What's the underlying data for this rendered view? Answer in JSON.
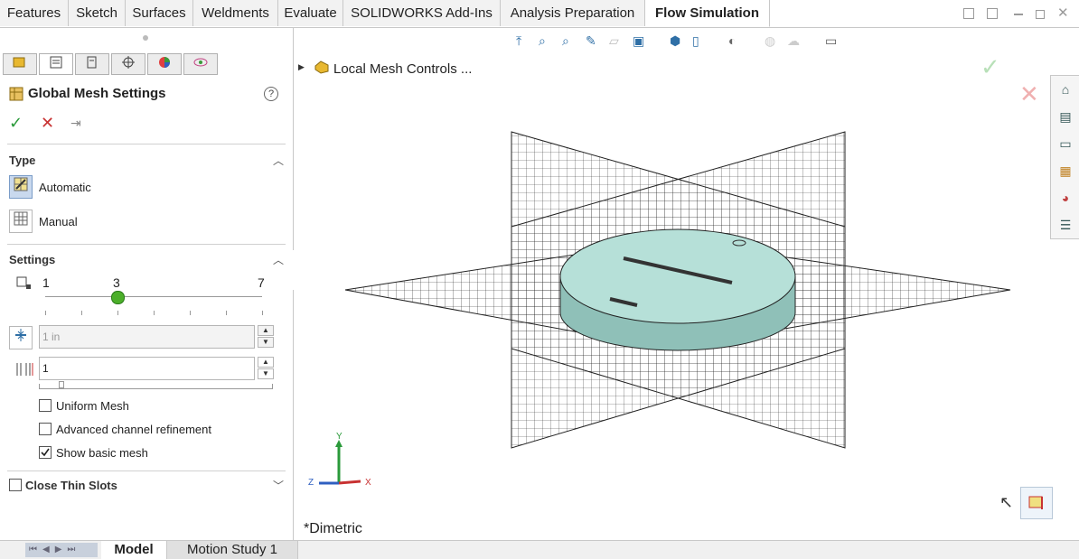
{
  "tabs": [
    {
      "label": "Features",
      "active": false
    },
    {
      "label": "Sketch",
      "active": false
    },
    {
      "label": "Surfaces",
      "active": false
    },
    {
      "label": "Weldments",
      "active": false
    },
    {
      "label": "Evaluate",
      "active": false
    },
    {
      "label": "SOLIDWORKS Add-Ins",
      "active": false
    },
    {
      "label": "Analysis Preparation",
      "active": false
    },
    {
      "label": "Flow Simulation",
      "active": true
    }
  ],
  "panel": {
    "title": "Global Mesh Settings",
    "help_icon": "help-icon",
    "ok_icon": "checkmark-icon",
    "cancel_icon": "close-icon",
    "pin_icon": "pushpin-icon",
    "type": {
      "heading": "Type",
      "options": [
        {
          "label": "Automatic",
          "selected": true
        },
        {
          "label": "Manual",
          "selected": false
        }
      ]
    },
    "settings": {
      "heading": "Settings",
      "slider": {
        "min_label": "1",
        "value_label": "3",
        "max_label": "7",
        "value": 3
      },
      "min_gap_value": "1 in",
      "count_value": "1",
      "checkboxes": [
        {
          "label": "Uniform Mesh",
          "checked": false
        },
        {
          "label": "Advanced channel refinement",
          "checked": false
        },
        {
          "label": "Show basic mesh",
          "checked": true
        }
      ]
    },
    "close_thin_slots": {
      "label": "Close Thin Slots",
      "checked": false
    }
  },
  "viewport": {
    "tree_item": "Local Mesh Controls ...",
    "view_label": "*Dimetric",
    "triad": {
      "y": "Y",
      "x": "X",
      "z": "Z"
    }
  },
  "bottom_tabs": [
    {
      "label": "Model",
      "active": true
    },
    {
      "label": "Motion Study 1",
      "active": false
    }
  ],
  "colors": {
    "accent": "#2f6fa6",
    "ok_green": "#2a9a3a",
    "cancel_red": "#c83232",
    "slider_knob": "#4caf2a",
    "model_fill": "#9fd0c8"
  }
}
